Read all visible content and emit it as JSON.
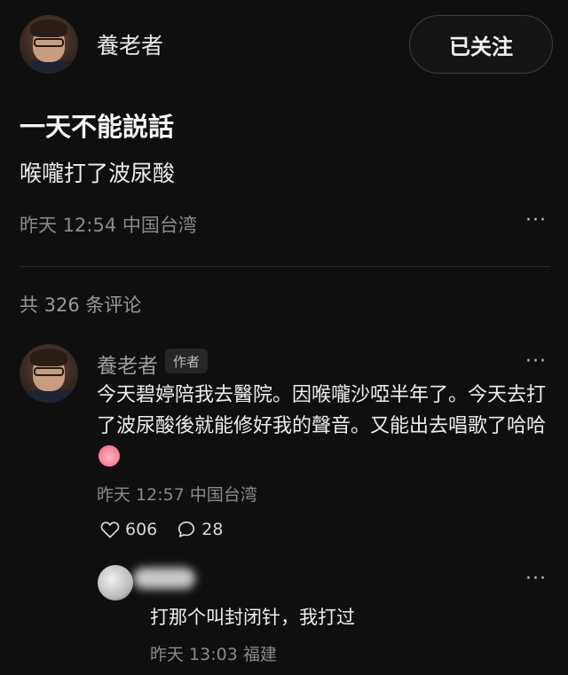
{
  "post": {
    "author": "養老者",
    "follow_label": "已关注",
    "title": "一天不能説話",
    "body": "喉嚨打了波尿酸",
    "meta": "昨天 12:54 中国台湾",
    "more": "···"
  },
  "comments": {
    "count_label": "共 326 条评论",
    "items": [
      {
        "author": "養老者",
        "tag": "作者",
        "text": "今天碧婷陪我去醫院。因喉嚨沙啞半年了。今天去打了波尿酸後就能修好我的聲音。又能出去唱歌了哈哈",
        "emoji": "pig-face-emoji",
        "meta": "昨天 12:57 中国台湾",
        "likes": "606",
        "replies": "28",
        "more": "···"
      }
    ],
    "reply": {
      "text": "打那个叫封闭针，我打过",
      "meta": "昨天 13:03 福建",
      "more": "···"
    }
  },
  "icons": {
    "like": "heart-outline-icon",
    "reply": "speech-bubble-icon"
  }
}
